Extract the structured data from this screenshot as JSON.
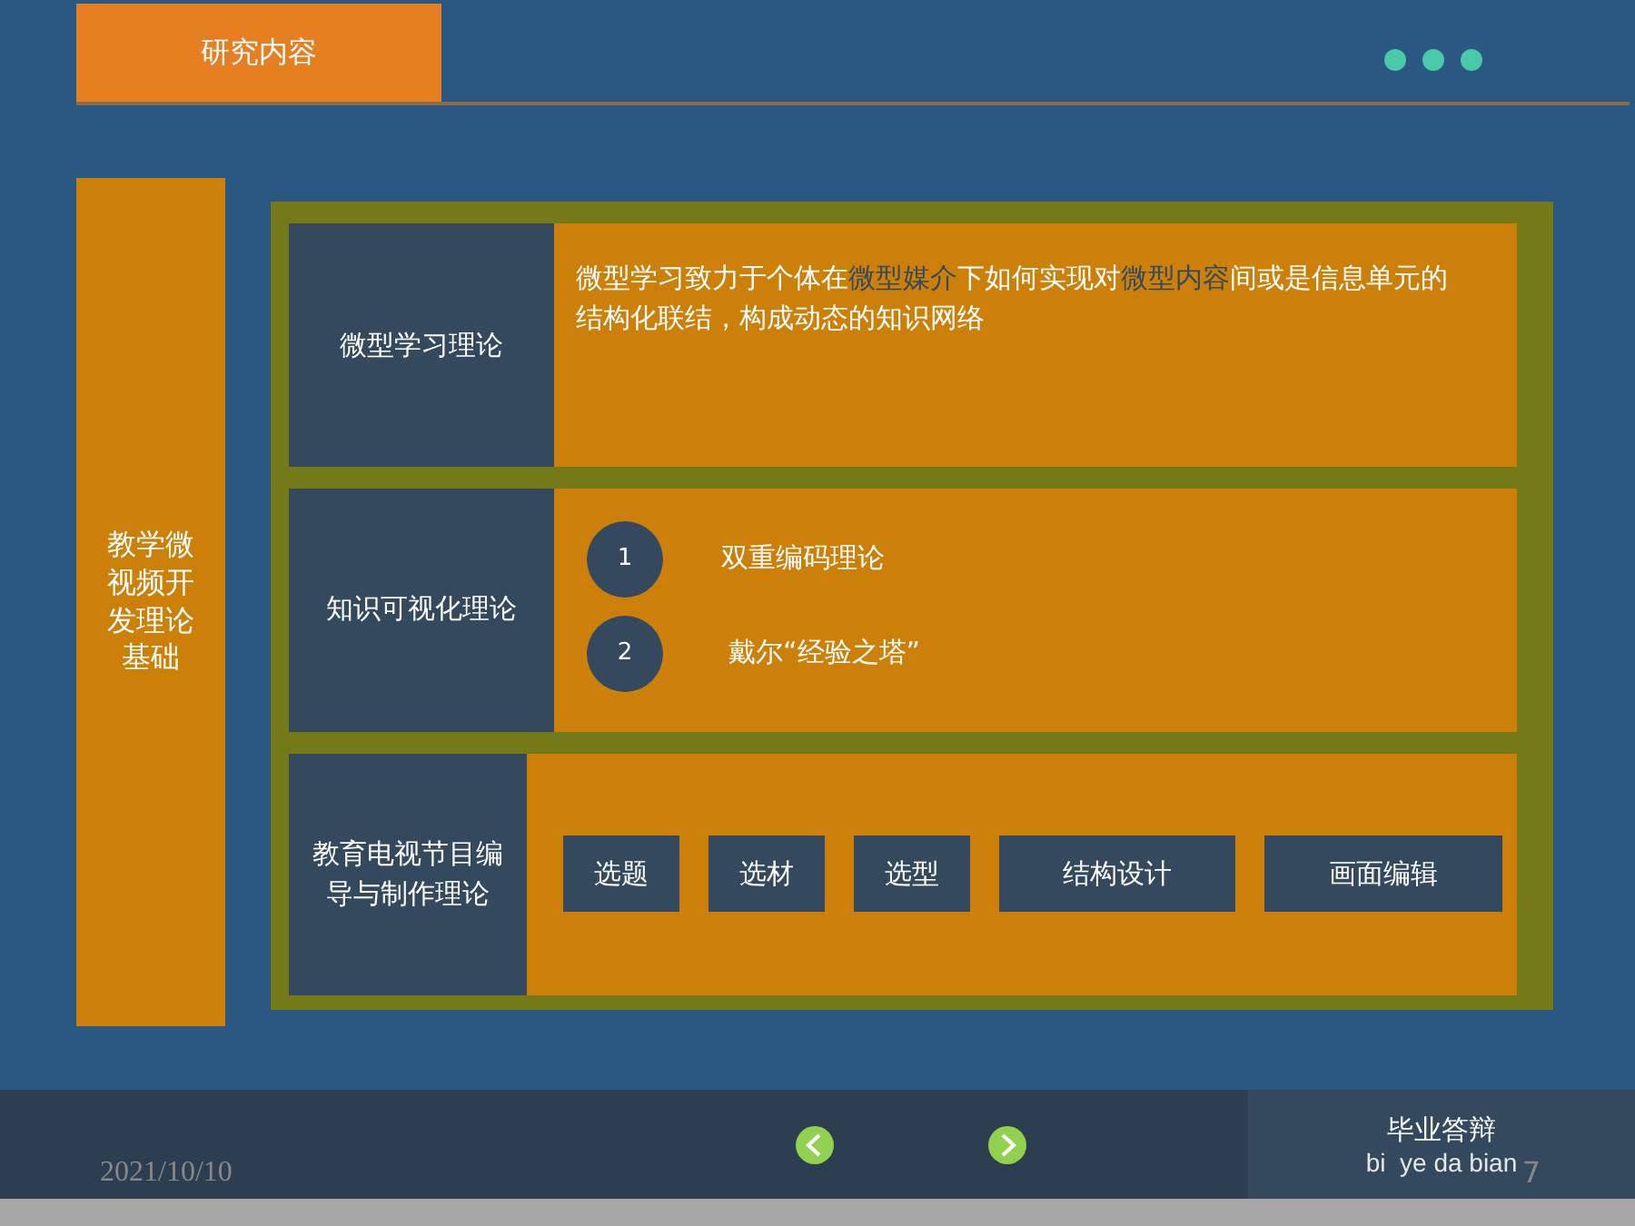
{
  "header": {
    "tab": "研究内容"
  },
  "sidebar": {
    "label": "教学微视频开发理论基础"
  },
  "rows": [
    {
      "kind": "text",
      "label": "微型学习理论",
      "segments": [
        {
          "text": "微型学习致力于个体在",
          "highlight": false
        },
        {
          "text": "微型媒介",
          "highlight": true
        },
        {
          "text": "下如何实现对",
          "highlight": false
        },
        {
          "text": "微型内容",
          "highlight": true
        },
        {
          "text": "间或是信息单元的结构化联结，构成动态的知识网络",
          "highlight": false
        }
      ]
    },
    {
      "kind": "list",
      "label": "知识可视化理论",
      "items": [
        {
          "number": "1",
          "text": "双重编码理论"
        },
        {
          "number": "2",
          "text": "戴尔“经验之塔”"
        }
      ]
    },
    {
      "kind": "buttons",
      "label": "教育电视节目编导与制作理论",
      "buttons": [
        "选题",
        "选材",
        "选型",
        "结构设计",
        "画面编辑"
      ]
    }
  ],
  "footer": {
    "date": "2021/10/10",
    "title": "毕业答辩",
    "subtitle": "bi  ye da bian",
    "page": "7"
  }
}
